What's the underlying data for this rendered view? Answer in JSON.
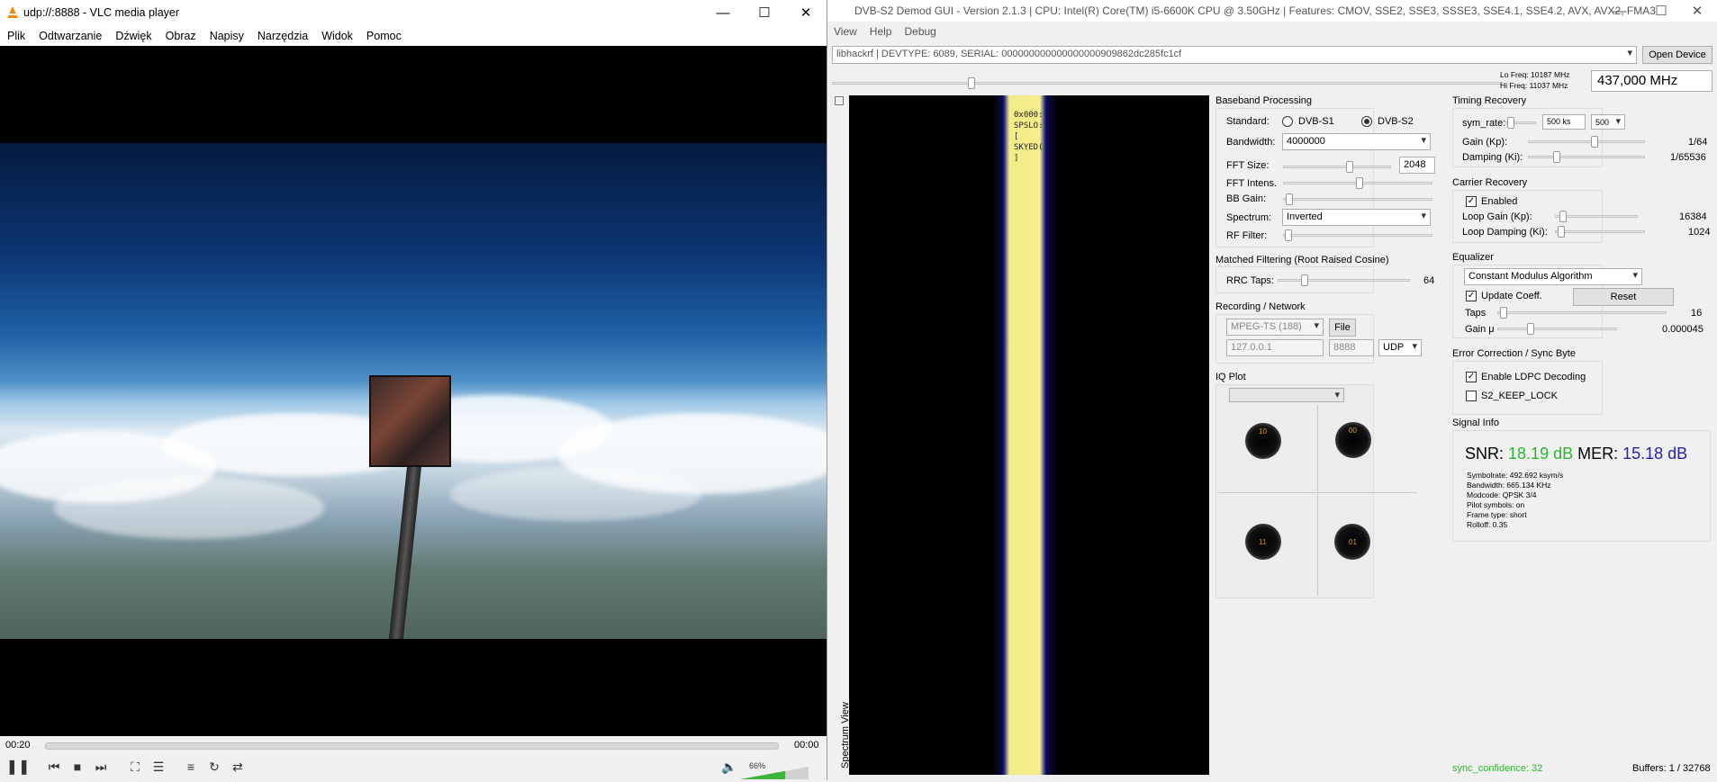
{
  "vlc": {
    "title": "udp://:8888 - VLC media player",
    "menu": [
      "Plik",
      "Odtwarzanie",
      "Dźwięk",
      "Obraz",
      "Napisy",
      "Narzędzia",
      "Widok",
      "Pomoc"
    ],
    "time_elapsed": "00:20",
    "time_total": "00:00",
    "volume": "66%",
    "volume_level": 0.66
  },
  "dvb": {
    "title": "DVB-S2 Demod GUI - Version 2.1.3 | CPU: Intel(R) Core(TM) i5-6600K CPU @ 3.50GHz | Features: CMOV, SSE2, SSE3, SSSE3, SSE4.1, SSE4.2, AVX, AVX2, FMA3",
    "menu": [
      "View",
      "Help",
      "Debug"
    ],
    "device": "libhackrf | DEVTYPE: 6089, SERIAL: 000000000000000000909862dc285fc1cf",
    "open_device": "Open Device",
    "lo_freq": "Lo Freq: 10187 MHz",
    "hi_freq": "Hi Freq: 11037 MHz",
    "frequency": "437,000 MHz",
    "spectrum_view": "Spectrum View",
    "waterfall_text": [
      "0x000:",
      "SPSLO:",
      "[",
      "SKYED(",
      "]"
    ],
    "baseband": {
      "title": "Baseband Processing",
      "standard_label": "Standard:",
      "dvbs1": "DVB-S1",
      "dvbs2": "DVB-S2",
      "bandwidth_label": "Bandwidth:",
      "bandwidth": "4000000",
      "fft_size_label": "FFT Size:",
      "fft_size": "2048",
      "fft_intens_label": "FFT Intens.",
      "bb_gain_label": "BB Gain:",
      "spectrum_label": "Spectrum:",
      "spectrum": "Inverted",
      "rf_filter_label": "RF Filter:"
    },
    "matched": {
      "title": "Matched Filtering (Root Raised Cosine)",
      "rrc_label": "RRC Taps:",
      "rrc_value": "64"
    },
    "recording": {
      "title": "Recording / Network",
      "format": "MPEG-TS (188)",
      "file_btn": "File",
      "ip": "127.0.0.1",
      "port": "8888",
      "proto": "UDP"
    },
    "iq": {
      "title": "IQ Plot",
      "labels": [
        "10",
        "00",
        "11",
        "01"
      ]
    },
    "timing": {
      "title": "Timing Recovery",
      "sym_label": "sym_rate:",
      "sym_value": "500 ks",
      "sym_step": "500",
      "gain_label": "Gain (Kp):",
      "gain_value": "1/64",
      "damp_label": "Damping (Ki):",
      "damp_value": "1/65536"
    },
    "carrier": {
      "title": "Carrier Recovery",
      "enabled": "Enabled",
      "loop_gain_label": "Loop Gain (Kp):",
      "loop_gain_value": "16384",
      "loop_damp_label": "Loop Damping (Ki):",
      "loop_damp_value": "1024"
    },
    "equalizer": {
      "title": "Equalizer",
      "algo": "Constant Modulus Algorithm",
      "update": "Update Coeff.",
      "reset": "Reset",
      "taps_label": "Taps",
      "taps_value": "16",
      "gain_label": "Gain μ",
      "gain_value": "0.000045"
    },
    "error": {
      "title": "Error Correction / Sync Byte",
      "ldpc": "Enable LDPC Decoding",
      "keep_lock": "S2_KEEP_LOCK"
    },
    "signal": {
      "title": "Signal Info",
      "snr_label": "SNR:",
      "snr_value": "18.19 dB",
      "mer_label": "MER:",
      "mer_value": "15.18 dB",
      "details": [
        "Symbolrate: 492.692 ksym/s",
        "Bandwidth: 665.134 KHz",
        "Modcode: QPSK 3/4",
        "Pilot symbols: on",
        "Frame type: short",
        "Rolloff: 0.35"
      ]
    },
    "sync_confidence": "sync_confidence: 32",
    "buffers": "Buffers: 1 / 32768",
    "colors": {
      "snr": "#2db52d",
      "mer": "#2222aa",
      "sync": "#2db52d"
    }
  }
}
